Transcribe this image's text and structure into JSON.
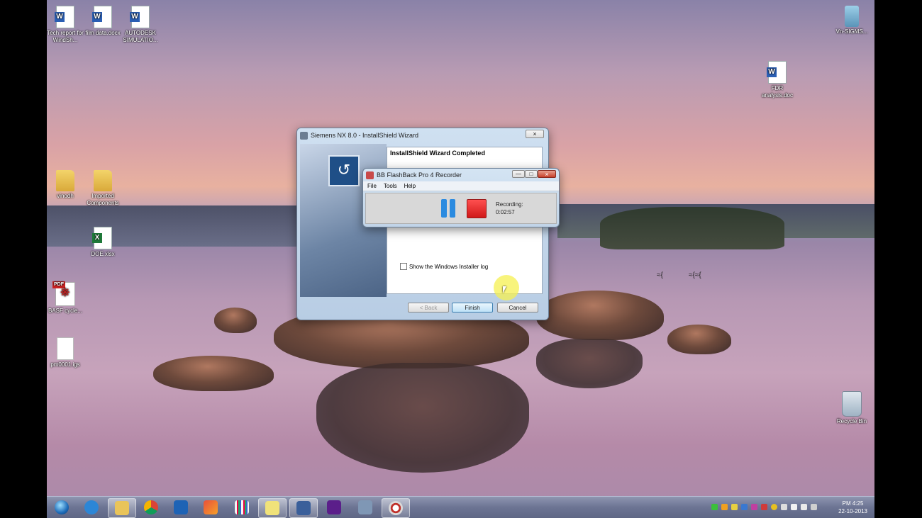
{
  "desktop": {
    "icons": [
      {
        "label": "Tech report for WindSh...",
        "icon": "word-doc-icon"
      },
      {
        "label": "film data.docx",
        "icon": "word-doc-icon"
      },
      {
        "label": "AUTODESK SIMULATIO...",
        "icon": "word-doc-icon"
      },
      {
        "label": "Vn-SIGMS...",
        "icon": "calculator-icon"
      },
      {
        "label": "FDR analysis.doc",
        "icon": "word-doc-icon"
      },
      {
        "label": "vinodh",
        "icon": "folder-icon"
      },
      {
        "label": "Imported Components",
        "icon": "folder-icon"
      },
      {
        "label": "DOE.xlsx",
        "icon": "excel-icon"
      },
      {
        "label": "BASF cycle...",
        "icon": "pdf-icon"
      },
      {
        "label": "pm0001.igs",
        "icon": "blank-file-icon"
      },
      {
        "label": "Recycle Bin",
        "icon": "recycle-bin-icon"
      }
    ]
  },
  "installer": {
    "title": "Siemens NX 8.0 - InstallShield Wizard",
    "heading": "InstallShield Wizard Completed",
    "checkbox_label": "Show the Windows Installer log",
    "back": "< Back",
    "finish": "Finish",
    "cancel": "Cancel"
  },
  "recorder": {
    "title": "BB FlashBack Pro 4 Recorder",
    "menu": [
      "File",
      "Tools",
      "Help"
    ],
    "status_label": "Recording:",
    "elapsed": "0:02:57"
  },
  "taskbar": {
    "apps": [
      "start-orb",
      "internet-explorer-icon",
      "file-explorer-icon",
      "chrome-icon",
      "outlook-icon",
      "app-icon",
      "grid-app-icon",
      "folder-app-icon",
      "installer-icon",
      "media-icon",
      "network-icon",
      "flashback-icon"
    ],
    "time": "PM 4:25",
    "date": "22-10-2013"
  },
  "colors": {
    "record_stop": "#e02020",
    "pause": "#2b8be0",
    "finish_border": "#3c7fb1"
  }
}
